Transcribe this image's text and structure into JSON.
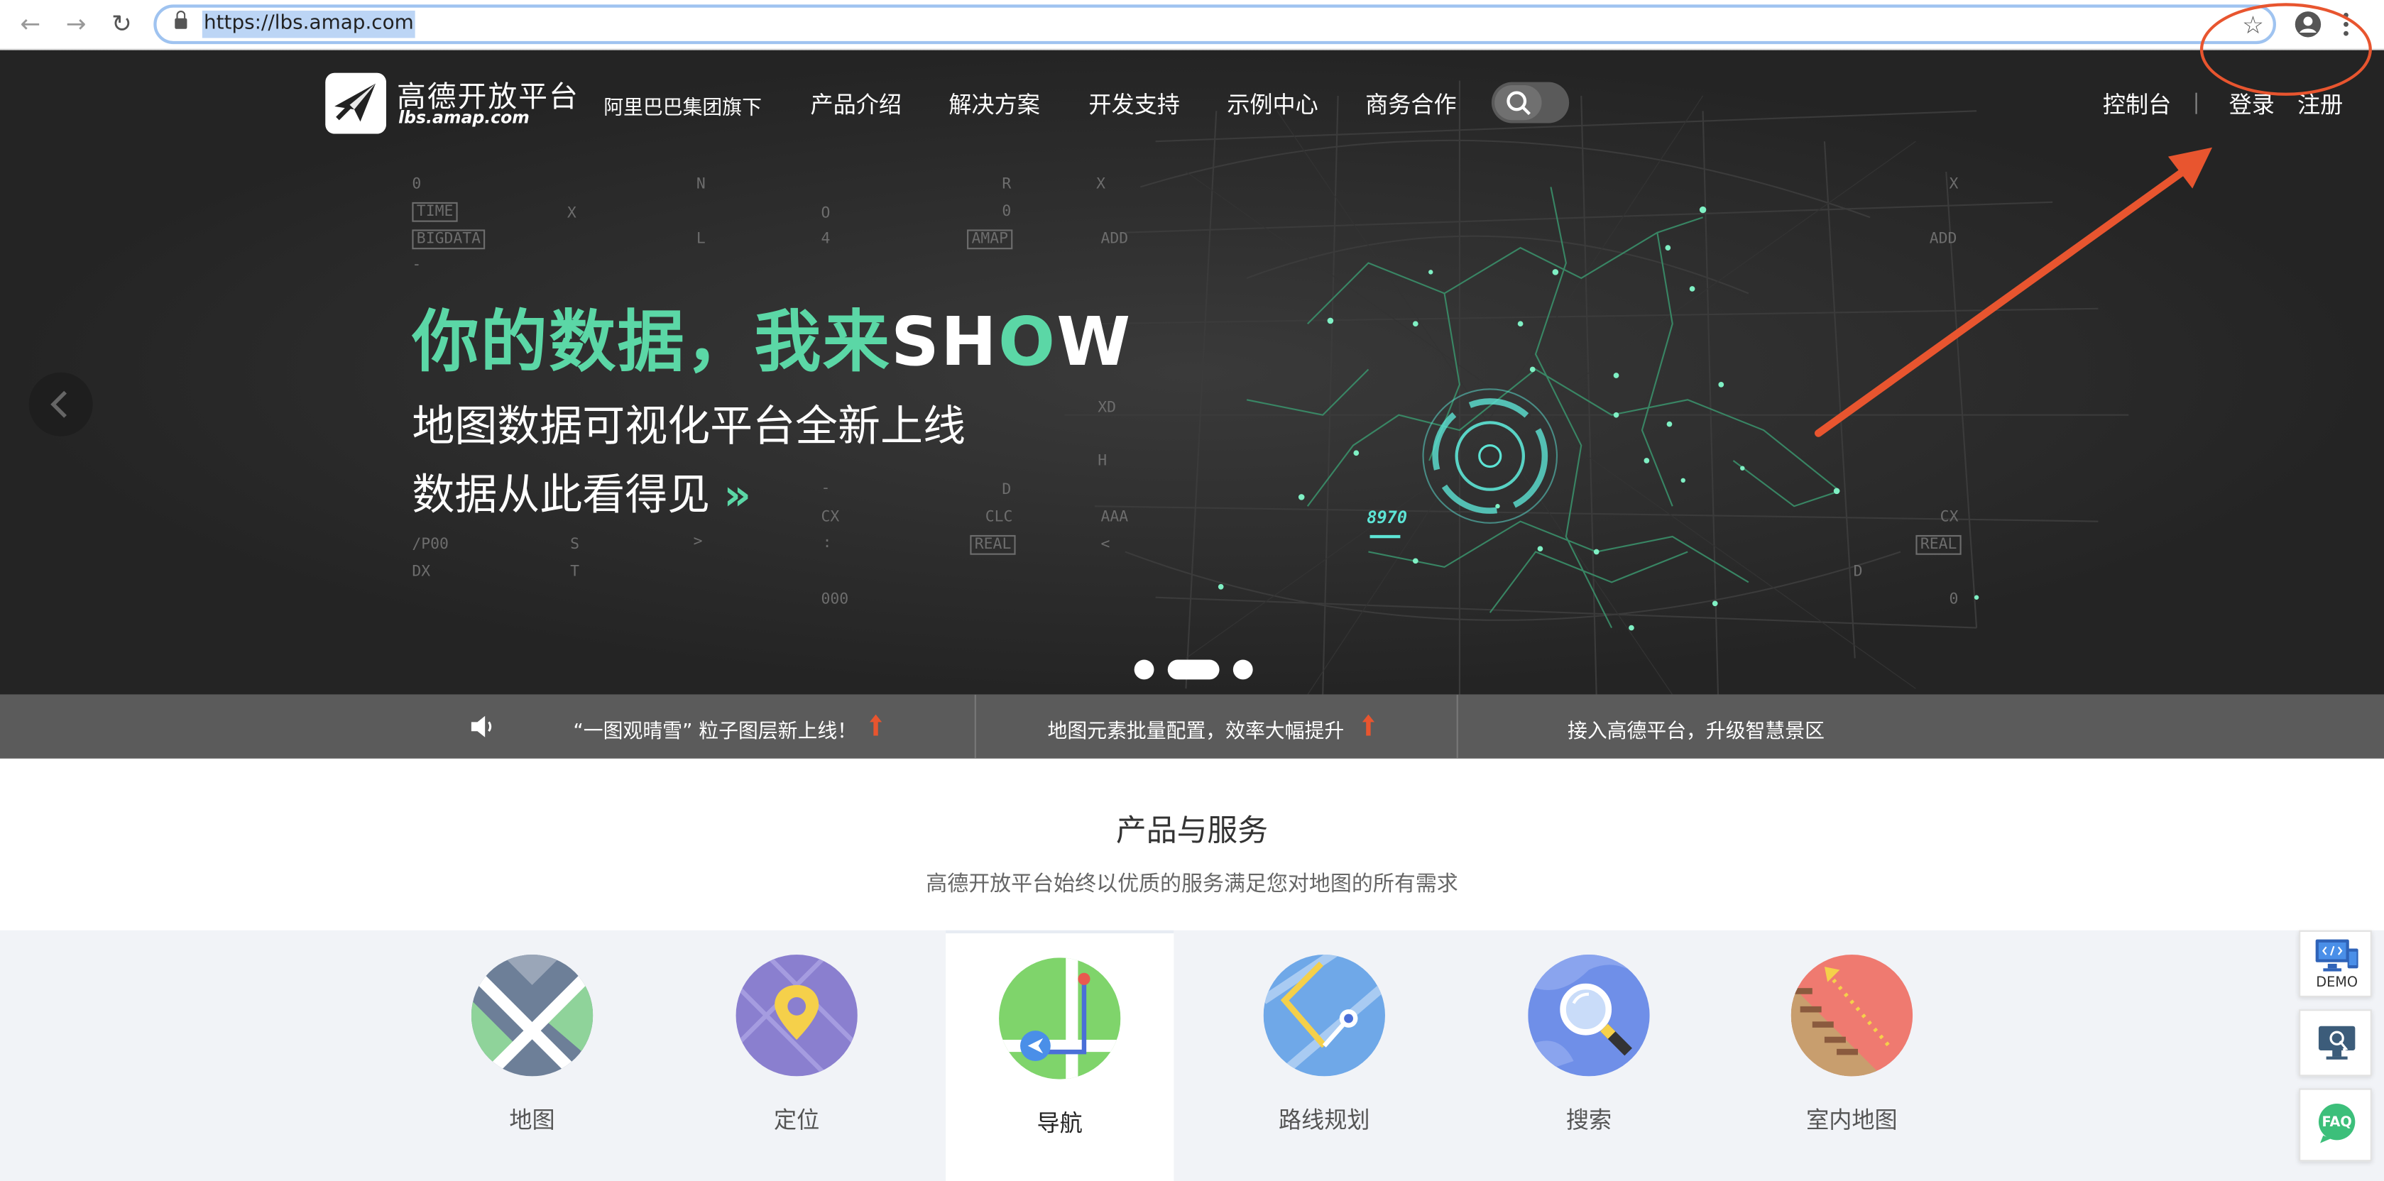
{
  "browser": {
    "url": "https://lbs.amap.com"
  },
  "header": {
    "logo_title": "高德开放平台",
    "logo_sub": "lbs.amap.com",
    "group": "阿里巴巴集团旗下",
    "nav": [
      "产品介绍",
      "解决方案",
      "开发支持",
      "示例中心",
      "商务合作"
    ],
    "console": "控制台",
    "login": "登录",
    "register": "注册"
  },
  "hero": {
    "headline": "你的数据，我来",
    "headline_show_s": "SH",
    "headline_show_o": "O",
    "headline_show_w": "W",
    "sub1": "地图数据可视化平台全新上线",
    "sub2": "数据从此看得见",
    "chevrons": "»",
    "hud_value": "8970",
    "slides_total": 3,
    "active_slide": 2,
    "deco_text": {
      "t0": "0",
      "time": "TIME",
      "bigdata": "BIGDATA",
      "x1": "X",
      "n": "N",
      "l": "L",
      "o": "O",
      "four": "4",
      "r": "R",
      "zero2": "0",
      "amap": "AMAP",
      "x2": "X",
      "add1": "ADD",
      "x3": "X",
      "add2": "ADD",
      "xd": "XD",
      "h": "H",
      "d1": "D",
      "clc": "CLC",
      "real1": "REAL",
      "cx1": "CX",
      "colon": ":",
      "aaa": "AAA",
      "p00": "/P00",
      "s": "S",
      "dx": "DX",
      "t": "T",
      "gt": ">",
      "lt": "<",
      "zeros": "000",
      "cx2": "CX",
      "real2": "REAL",
      "d2": "D",
      "zero3": "0",
      "dash1": "-",
      "dash2": "-"
    }
  },
  "news": [
    "“一图观晴雪” 粒子图层新上线！",
    "地图元素批量配置，效率大幅提升",
    "接入高德平台，升级智慧景区"
  ],
  "section": {
    "title": "产品与服务",
    "subtitle": "高德开放平台始终以优质的服务满足您对地图的所有需求"
  },
  "products": [
    {
      "label": "地图",
      "icon": "map-icon"
    },
    {
      "label": "定位",
      "icon": "location-icon"
    },
    {
      "label": "导航",
      "icon": "navigation-icon"
    },
    {
      "label": "路线规划",
      "icon": "route-planning-icon"
    },
    {
      "label": "搜索",
      "icon": "search-icon"
    },
    {
      "label": "室内地图",
      "icon": "indoor-map-icon"
    }
  ],
  "side": {
    "demo": "DEMO",
    "faq": "FAQ"
  },
  "colors": {
    "accent_green": "#5bd7a6",
    "annotation_red": "#e8552f",
    "hero_bg": "#2a2a2a",
    "news_bg": "#5b5b5b"
  }
}
